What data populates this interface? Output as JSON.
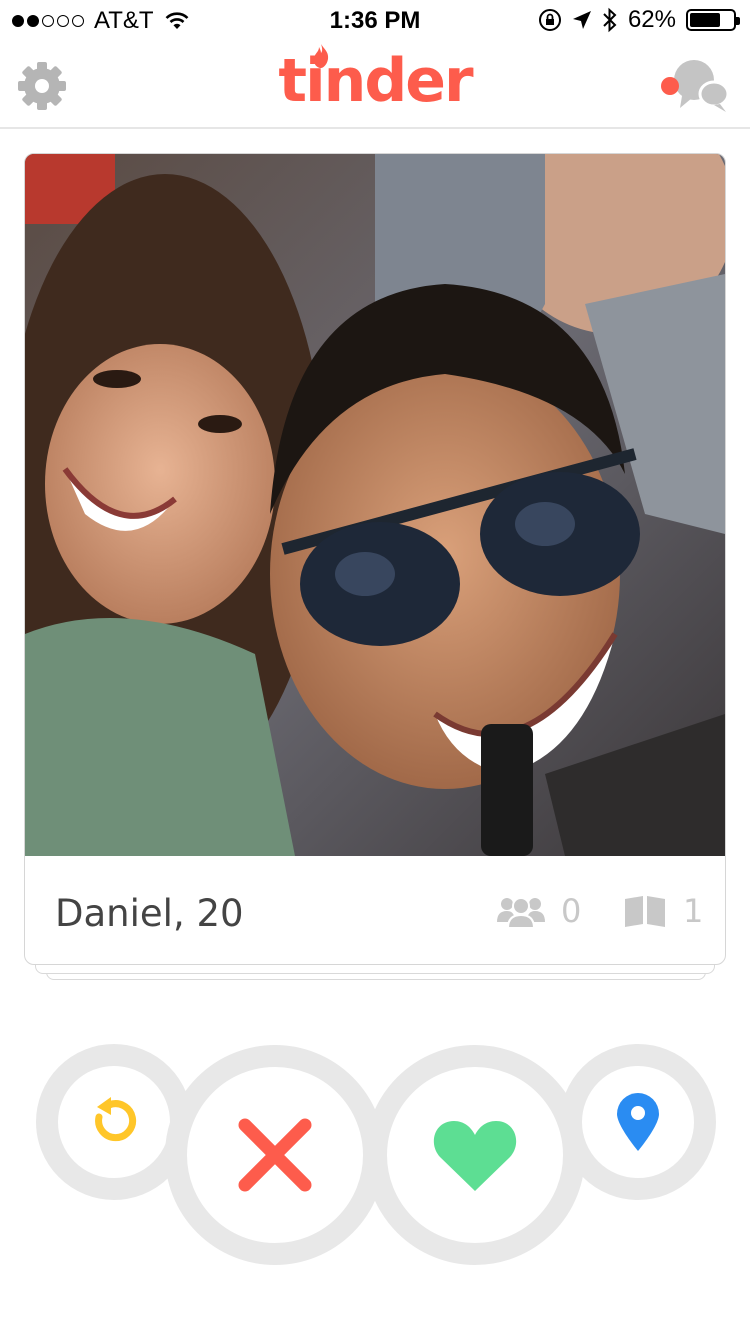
{
  "status_bar": {
    "carrier": "AT&T",
    "time": "1:36 PM",
    "battery_percent": "62%",
    "battery_level": 0.62,
    "signal_bars_filled": 2,
    "signal_bars_total": 5
  },
  "nav": {
    "logo_text": "tinder",
    "brand_color": "#fd5c4c",
    "left_icon": "gear-icon",
    "right_icon": "chat-bubbles-icon",
    "has_notification": true
  },
  "card": {
    "name_age": "Daniel, 20",
    "common_friends": "0",
    "common_interests": "1",
    "photo_description_icon": "profile-photo"
  },
  "actions": {
    "undo_icon": "undo-icon",
    "undo_color": "#ffc629",
    "nope_icon": "close-icon",
    "nope_color": "#fd5c4c",
    "like_icon": "heart-icon",
    "like_color": "#5dde93",
    "location_icon": "location-pin-icon",
    "location_color": "#2a8cf2"
  }
}
